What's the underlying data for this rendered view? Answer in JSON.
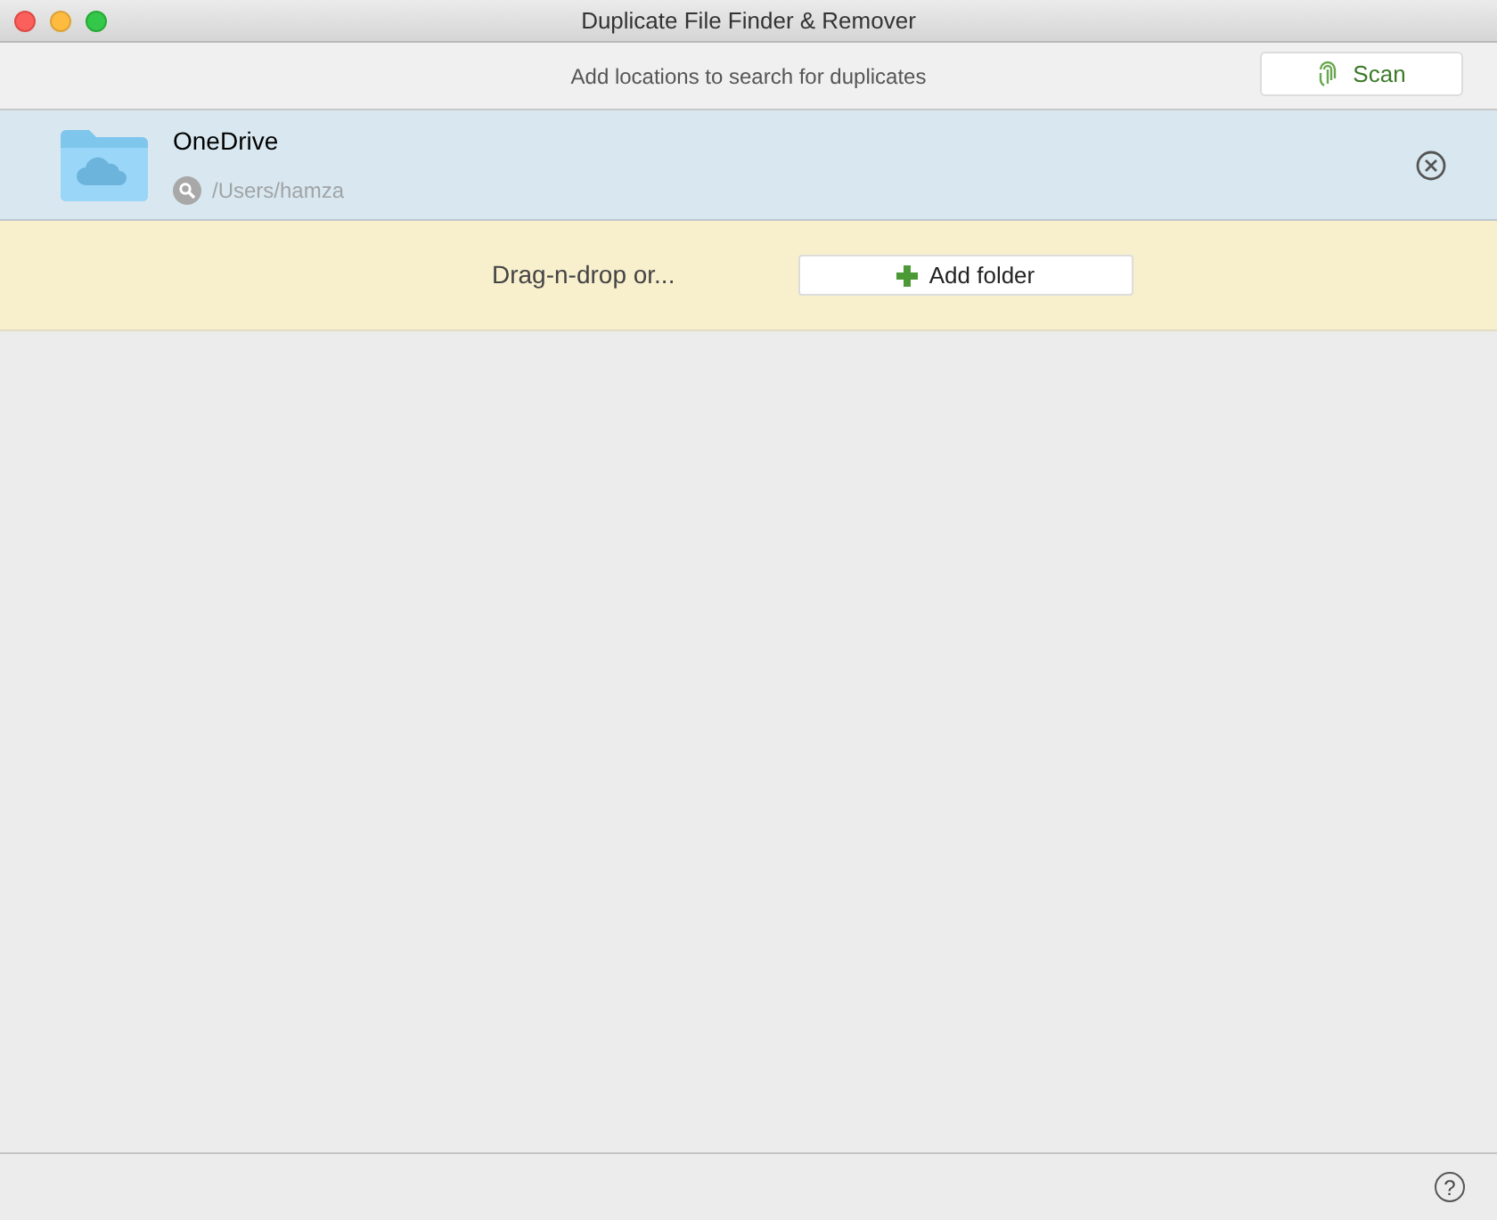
{
  "window": {
    "title": "Duplicate File Finder & Remover"
  },
  "toolbar": {
    "hint": "Add locations to search for duplicates",
    "scan_button": "Scan"
  },
  "locations": [
    {
      "name": "OneDrive",
      "path": "/Users/hamza"
    }
  ],
  "drop_zone": {
    "text": "Drag-n-drop or...",
    "add_button": "Add folder"
  },
  "status_bar": {
    "help_button": "?"
  }
}
